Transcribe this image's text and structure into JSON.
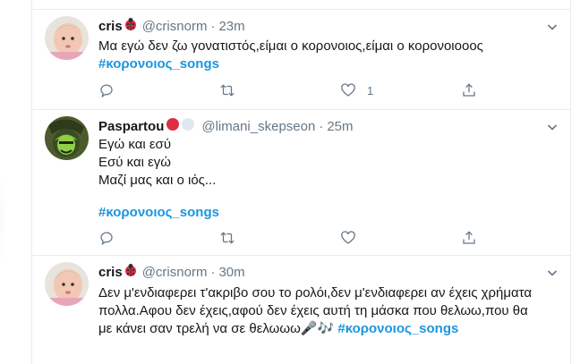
{
  "tweets": [
    {
      "name": "cris",
      "handle": "@crisnorm",
      "dot": "·",
      "time": "23m",
      "lines": [
        "Μα εγώ δεν ζω γονατιστός,είμαι ο κορονοιος,είμαι ο κορονοιοοος"
      ],
      "hashtag": "#κορονοιος_songs",
      "like_count": "1",
      "retweet_count": "",
      "reply_count": ""
    },
    {
      "name": "Paspartou",
      "handle": "@limani_skepseon",
      "dot": "·",
      "time": "25m",
      "lines": [
        "Εγώ και εσύ",
        "Εσύ και εγώ",
        "Μαζί μας και ο ιός..."
      ],
      "hashtag": "#κορονοιος_songs",
      "like_count": "",
      "retweet_count": "",
      "reply_count": ""
    },
    {
      "name": "cris",
      "handle": "@crisnorm",
      "dot": "·",
      "time": "30m",
      "lines": [
        "Δεν μ'ενδιαφερει τ'ακριβο σου το ρολόι,δεν μ'ενδιαφερει αν έχεις χρήματα",
        "πολλα.Αφου δεν έχεις,αφού δεν έχεις αυτή τη μάσκα που θελωω,που θα",
        "με κάνει σαν τρελή να σε θελωωω"
      ],
      "music_emoji": "🎤🎶",
      "hashtag": "#κορονοιος_songs"
    }
  ],
  "icons": {
    "reply": "reply-icon",
    "retweet": "retweet-icon",
    "like": "heart-icon",
    "share": "share-icon",
    "caret": "chevron-down-icon",
    "ladybug": "ladybug-emoji",
    "circles": "red-white-circles-emoji"
  },
  "colors": {
    "hashtag": "#1b95e0",
    "secondary_text": "#657786",
    "divider": "#e6ecf0"
  }
}
